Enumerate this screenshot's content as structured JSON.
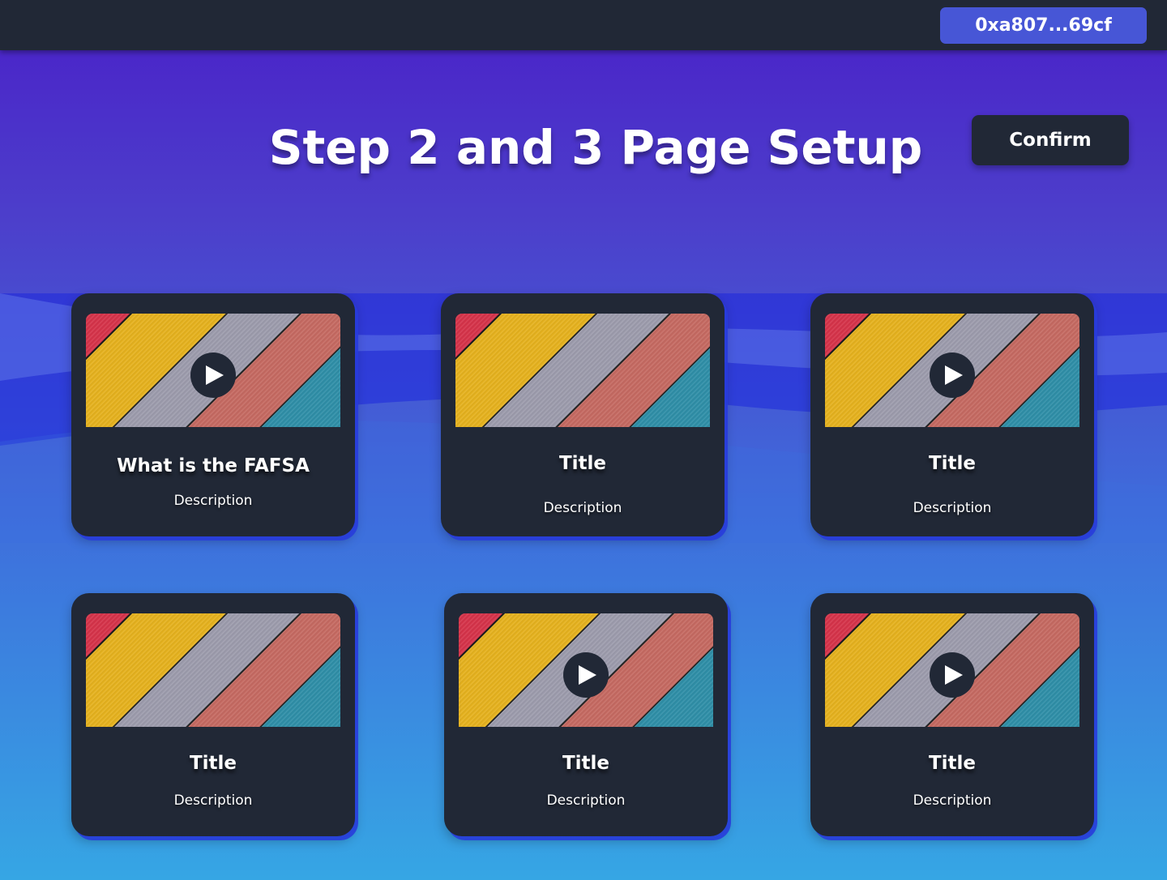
{
  "header": {
    "wallet_address": "0xa807...69cf"
  },
  "page": {
    "title": "Step 2 and 3 Page Setup",
    "confirm_label": "Confirm"
  },
  "cards": [
    {
      "title": "What is the FAFSA",
      "description": "Description",
      "has_play": true
    },
    {
      "title": "Title",
      "description": "Description",
      "has_play": false
    },
    {
      "title": "Title",
      "description": "Description",
      "has_play": true
    },
    {
      "title": "Title",
      "description": "Description",
      "has_play": false
    },
    {
      "title": "Title",
      "description": "Description",
      "has_play": true
    },
    {
      "title": "Title",
      "description": "Description",
      "has_play": true
    }
  ],
  "colors": {
    "topbar": "#212836",
    "wallet_button": "#4756d6",
    "card": "#212836"
  }
}
